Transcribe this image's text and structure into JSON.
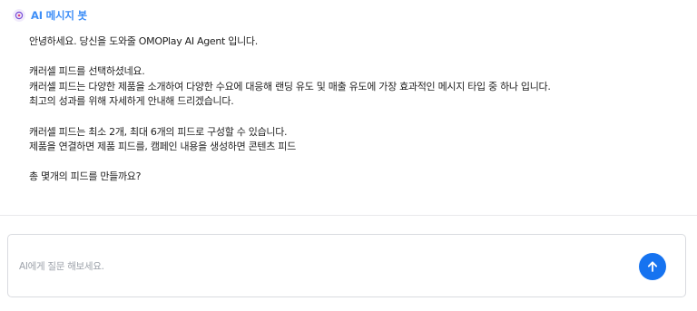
{
  "bot": {
    "name": "AI 메시지 봇",
    "avatar_icon": "bot-avatar-icon",
    "accent_color": "#3d8ef7"
  },
  "message": {
    "lines": [
      "안녕하세요. 당신을 도와줄 OMOPlay AI Agent 입니다.",
      "",
      "캐러셀 피드를 선택하셨네요.",
      "캐러셀 피드는 다양한 제품을 소개하여 다양한 수요에 대응해 랜딩 유도 및 매출 유도에 가장 효과적인 메시지 타입 중 하나 입니다.",
      "최고의 성과를 위해 자세하게 안내해 드리겠습니다.",
      "",
      "캐러셀 피드는 최소 2개, 최대 6개의 피드로 구성할 수 있습니다.",
      "제품을 연결하면 제품 피드를, 캠페인 내용을 생성하면 콘텐츠 피드",
      "",
      "총 몇개의 피드를 만들까요?"
    ]
  },
  "composer": {
    "value": "",
    "placeholder": "AI에게 질문 해보세요.",
    "send_icon": "arrow-up-icon",
    "send_color": "#1673f0"
  }
}
